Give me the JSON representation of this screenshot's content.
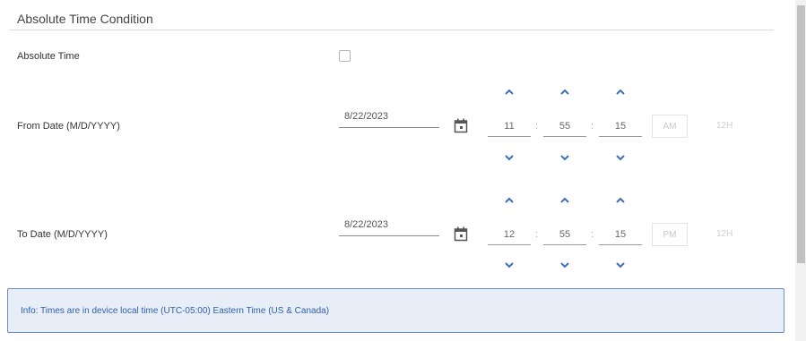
{
  "section": {
    "title": "Absolute Time Condition"
  },
  "absolute_time": {
    "label": "Absolute Time",
    "checked": false
  },
  "from": {
    "label": "From Date (M/D/YYYY)",
    "date": "8/22/2023",
    "hour": "11",
    "minute": "55",
    "second": "15",
    "ampm": "AM",
    "format": "12H"
  },
  "to": {
    "label": "To Date (M/D/YYYY)",
    "date": "8/22/2023",
    "hour": "12",
    "minute": "55",
    "second": "15",
    "ampm": "PM",
    "format": "12H"
  },
  "separator": ":",
  "info": {
    "text": "Info: Times are in device local time (UTC-05:00) Eastern Time (US & Canada)"
  },
  "icons": {
    "calendar": "calendar-icon",
    "up": "chevron-up-icon",
    "down": "chevron-down-icon"
  },
  "colors": {
    "accent": "#3f6fb5",
    "info_bg": "#e8eef8",
    "info_border": "#6d8dc2"
  }
}
